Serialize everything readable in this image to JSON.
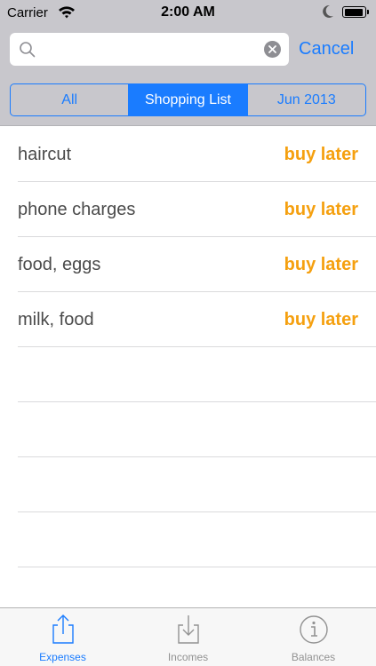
{
  "status_bar": {
    "carrier": "Carrier",
    "time": "2:00 AM"
  },
  "search": {
    "value": "",
    "placeholder": "",
    "cancel_label": "Cancel"
  },
  "filters": [
    {
      "label": "All",
      "selected": false
    },
    {
      "label": "Shopping List",
      "selected": true
    },
    {
      "label": "Jun 2013",
      "selected": false
    }
  ],
  "items": [
    {
      "name": "haircut",
      "status": "buy later"
    },
    {
      "name": "phone charges",
      "status": "buy later"
    },
    {
      "name": "food, eggs",
      "status": "buy later"
    },
    {
      "name": "milk, food",
      "status": "buy later"
    }
  ],
  "tabs": [
    {
      "label": "Expenses",
      "icon": "upload-icon",
      "active": true
    },
    {
      "label": "Incomes",
      "icon": "download-icon",
      "active": false
    },
    {
      "label": "Balances",
      "icon": "info-icon",
      "active": false
    }
  ],
  "colors": {
    "accent": "#1a7cff",
    "status": "#f5a00f",
    "header_bg": "#c8c7cc"
  }
}
